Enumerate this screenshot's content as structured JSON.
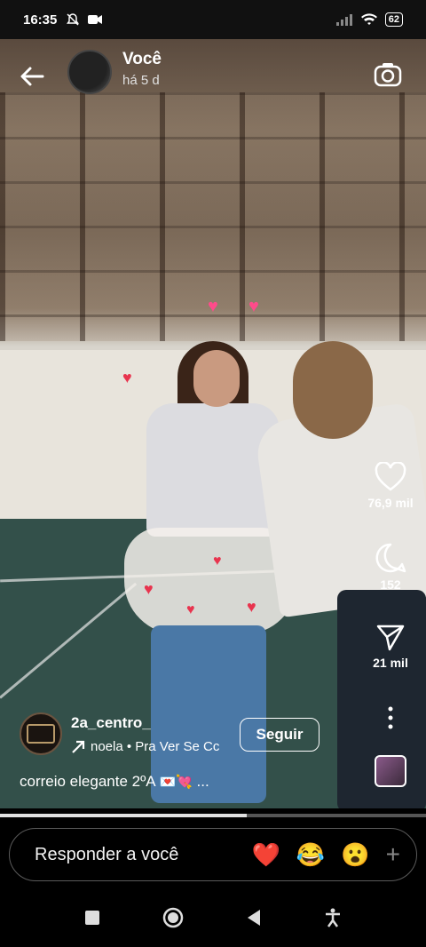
{
  "status_bar": {
    "time": "16:35",
    "battery": "62",
    "icons": [
      "mute-icon",
      "video-icon",
      "signal-icon",
      "wifi-icon",
      "battery-icon"
    ]
  },
  "header": {
    "title": "Você",
    "subtitle": "há 5 d"
  },
  "actions": {
    "likes": "76,9 mil",
    "comments": "152",
    "shares": "21 mil"
  },
  "creator": {
    "username": "2a_centro_",
    "audio": "noela • Pra Ver Se Cc",
    "follow_label": "Seguir"
  },
  "caption": {
    "text": "correio elegante 2ºA",
    "emojis": "💌💘",
    "more": "..."
  },
  "progress": {
    "fraction": 0.58
  },
  "reply": {
    "placeholder": "Responder a você",
    "quick_reactions": [
      "❤️",
      "😂",
      "😮"
    ],
    "add": "+"
  },
  "colors": {
    "background": "#000000",
    "heart": "#e8344e"
  }
}
